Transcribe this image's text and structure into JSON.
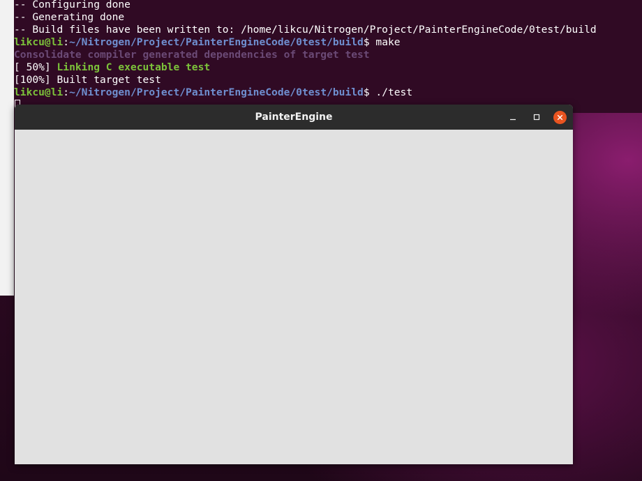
{
  "terminal": {
    "lines": {
      "l0": "-- Configuring done",
      "l1": "-- Generating done",
      "l2": "-- Build files have been written to: /home/likcu/Nitrogen/Project/PainterEngineCode/0test/build",
      "l3_user": "likcu@li",
      "l3_colon": ":",
      "l3_path": "~/Nitrogen/Project/PainterEngineCode/0test/build",
      "l3_cmd": "$ make",
      "l4": "Consolidate compiler generated dependencies of target test",
      "l5_prefix": "[ 50%] ",
      "l5_text": "Linking C executable test",
      "l6": "[100%] Built target test",
      "l7_user": "likcu@li",
      "l7_colon": ":",
      "l7_path": "~/Nitrogen/Project/PainterEngineCode/0test/build",
      "l7_cmd": "$ ./test"
    }
  },
  "app_window": {
    "title": "PainterEngine",
    "buttons": {
      "minimize": "minimize-icon",
      "maximize": "maximize-icon",
      "close": "close-icon"
    }
  },
  "colors": {
    "prompt_user": "#7cc23a",
    "prompt_path": "#6f8fd0",
    "terminal_bg": "#300a24",
    "close_button": "#e95420",
    "client_bg": "#e1e1e1"
  }
}
